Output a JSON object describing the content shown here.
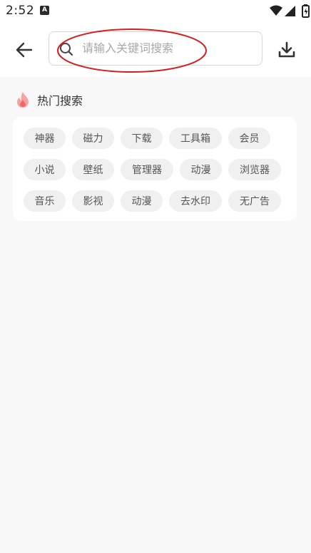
{
  "status_bar": {
    "time": "2:52",
    "notification_icon_letter": "A",
    "icons": [
      "wifi-icon",
      "cell-signal-icon",
      "battery-icon"
    ]
  },
  "header": {
    "back_icon": "arrow-left-icon",
    "search": {
      "placeholder": "请输入关键词搜索",
      "value": ""
    },
    "download_icon": "download-icon"
  },
  "hot_search": {
    "title": "热门搜索",
    "icon": "flame-icon",
    "accent_color": "#f28b8b",
    "rows": [
      [
        "神器",
        "磁力",
        "下载",
        "工具箱",
        "会员"
      ],
      [
        "小说",
        "壁纸",
        "管理器",
        "动漫",
        "浏览器"
      ],
      [
        "音乐",
        "影视",
        "动漫",
        "去水印",
        "无广告"
      ]
    ]
  },
  "annotation_color": "#d42020"
}
